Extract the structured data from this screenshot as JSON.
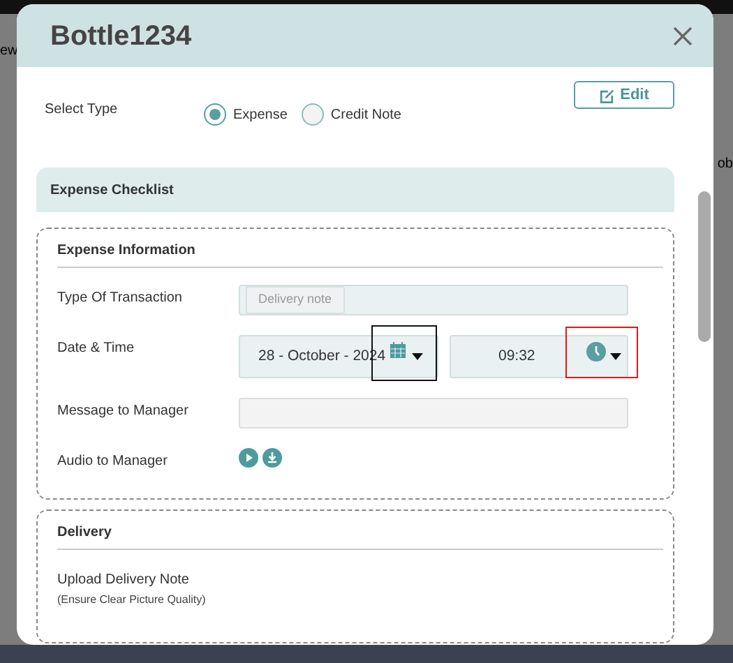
{
  "backdrop": {
    "left_text": "ew",
    "right_text": "ob"
  },
  "modal": {
    "title": "Bottle1234",
    "edit_button": "Edit",
    "select_type": {
      "label": "Select Type",
      "options": [
        {
          "label": "Expense",
          "selected": true
        },
        {
          "label": "Credit Note",
          "selected": false
        }
      ]
    },
    "checklist_title": "Expense Checklist",
    "sections": [
      {
        "title": "Expense Information",
        "fields": [
          {
            "kind": "tag",
            "label": "Type Of Transaction",
            "tag": "Delivery note"
          },
          {
            "kind": "datetime",
            "label": "Date & Time",
            "date": "28 - October - 2024",
            "time": "09:32",
            "annotation_frames": [
              {
                "color": "#111111"
              },
              {
                "color": "#e01818"
              }
            ]
          },
          {
            "kind": "text",
            "label": "Message to Manager"
          },
          {
            "kind": "audio",
            "label": "Audio to Manager"
          }
        ]
      },
      {
        "title": "Delivery",
        "fields": [
          {
            "kind": "upload",
            "label": "Upload Delivery Note",
            "hint": "(Ensure Clear Picture Quality)"
          }
        ]
      }
    ]
  }
}
